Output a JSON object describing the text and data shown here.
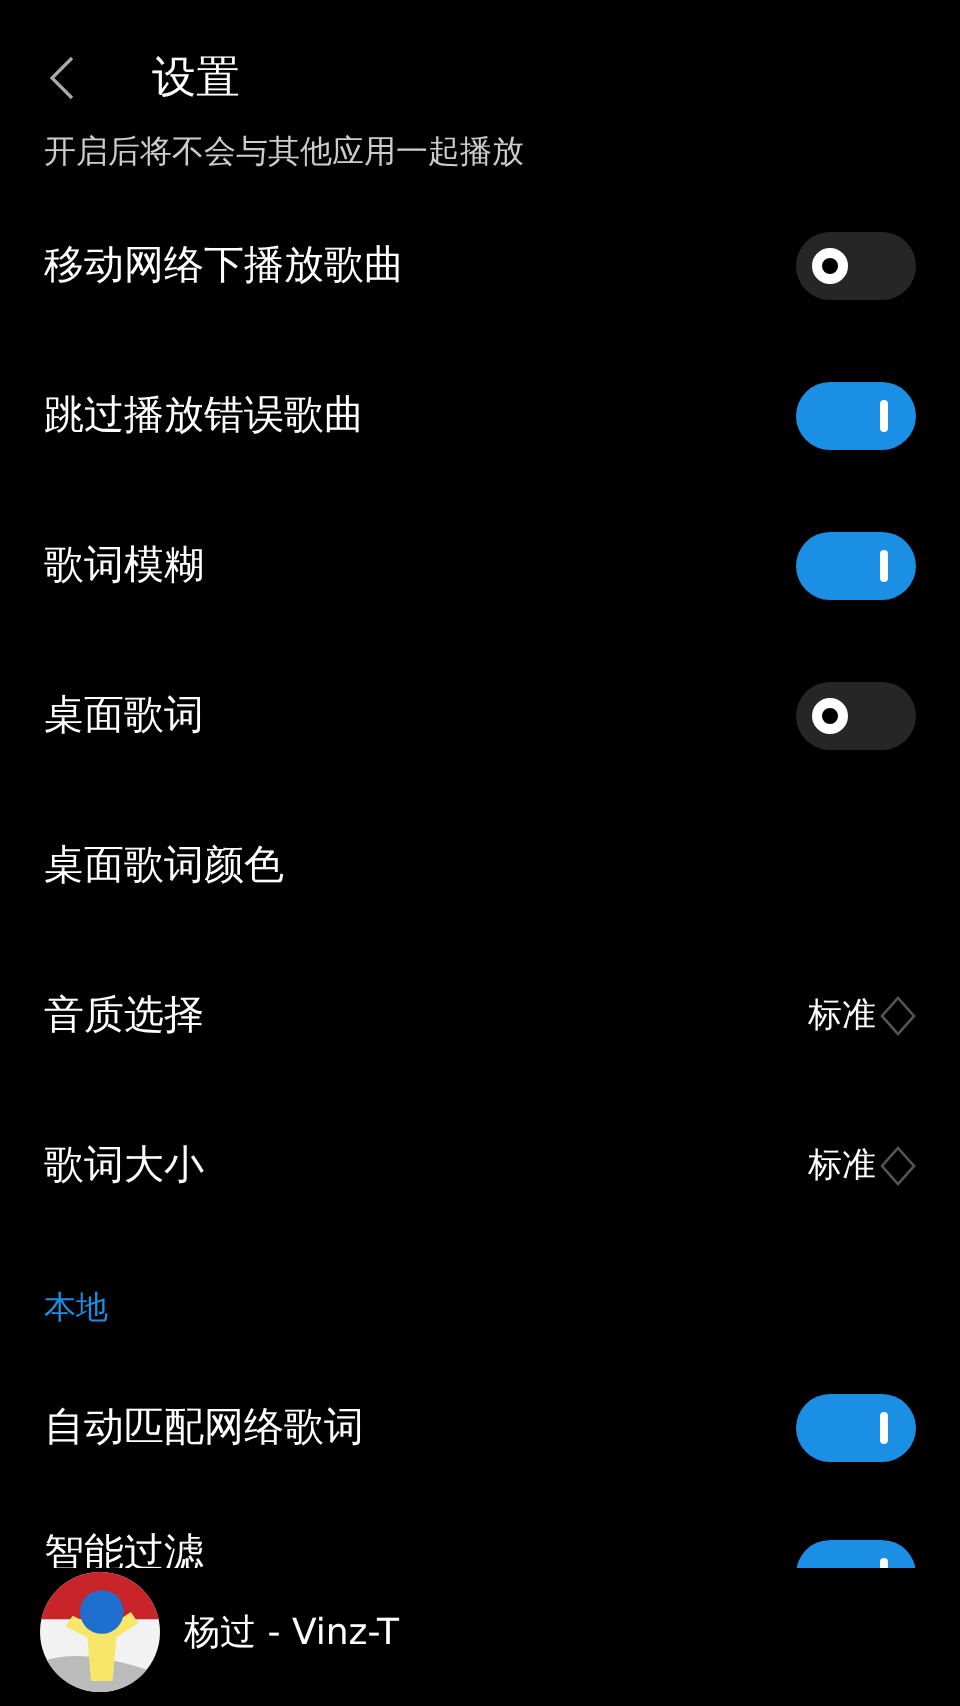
{
  "header": {
    "title": "设置"
  },
  "note": "开启后将不会与其他应用一起播放",
  "sections": [
    {
      "items": [
        {
          "kind": "toggle",
          "label": "移动网络下播放歌曲",
          "on": false
        },
        {
          "kind": "toggle",
          "label": "跳过播放错误歌曲",
          "on": true
        },
        {
          "kind": "toggle",
          "label": "歌词模糊",
          "on": true
        },
        {
          "kind": "toggle",
          "label": "桌面歌词",
          "on": false
        },
        {
          "kind": "plain",
          "label": "桌面歌词颜色"
        },
        {
          "kind": "value",
          "label": "音质选择",
          "value": "标准"
        },
        {
          "kind": "value",
          "label": "歌词大小",
          "value": "标准"
        }
      ]
    },
    {
      "title": "本地",
      "items": [
        {
          "kind": "toggle",
          "label": "自动匹配网络歌词",
          "on": true
        },
        {
          "kind": "toggle",
          "label": "智能过滤",
          "on": true
        }
      ]
    }
  ],
  "player": {
    "song": "杨过 - Vinz-T"
  }
}
